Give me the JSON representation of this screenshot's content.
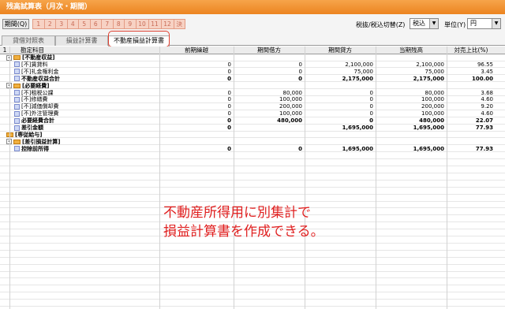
{
  "window": {
    "title": "残高試算表（月次・期間）"
  },
  "period": {
    "button_label": "期間(Q)",
    "months": [
      "1",
      "2",
      "3",
      "4",
      "5",
      "6",
      "7",
      "8",
      "9",
      "10",
      "11",
      "12",
      "決"
    ]
  },
  "tax": {
    "label": "税抜/税込切替(Z)",
    "value": "税込"
  },
  "unit": {
    "label": "単位(Y)",
    "value": "円"
  },
  "tabs": [
    "貸借対照表",
    "損益計算書",
    "不動産損益計算書"
  ],
  "grid": {
    "corner": "1",
    "headers": [
      "勘定科目",
      "前期繰越",
      "期間借方",
      "期間貸方",
      "当期残高",
      "対売上比(%)"
    ],
    "rows": [
      {
        "level": 0,
        "icon": "folder",
        "expand": "-",
        "name": "[不動産収益]",
        "vals": [
          "",
          "",
          "",
          "",
          ""
        ],
        "bold": true
      },
      {
        "level": 1,
        "icon": "doc",
        "name": "[不]賃貸料",
        "vals": [
          "0",
          "0",
          "2,100,000",
          "2,100,000",
          "96.55"
        ]
      },
      {
        "level": 1,
        "icon": "doc",
        "name": "[不]礼金権利金",
        "vals": [
          "0",
          "0",
          "75,000",
          "75,000",
          "3.45"
        ]
      },
      {
        "level": 1,
        "icon": "doc",
        "name": "不動産収益合計",
        "vals": [
          "0",
          "0",
          "2,175,000",
          "2,175,000",
          "100.00"
        ],
        "bold": true
      },
      {
        "level": 0,
        "icon": "folder",
        "expand": "-",
        "name": "[必要経費]",
        "vals": [
          "",
          "",
          "",
          "",
          ""
        ],
        "bold": true
      },
      {
        "level": 1,
        "icon": "doc",
        "name": "[不]租税公課",
        "vals": [
          "0",
          "80,000",
          "0",
          "80,000",
          "3.68"
        ]
      },
      {
        "level": 1,
        "icon": "doc",
        "name": "[不]修繕費",
        "vals": [
          "0",
          "100,000",
          "0",
          "100,000",
          "4.60"
        ]
      },
      {
        "level": 1,
        "icon": "doc",
        "name": "[不]減価償却費",
        "vals": [
          "0",
          "200,000",
          "0",
          "200,000",
          "9.20"
        ]
      },
      {
        "level": 1,
        "icon": "doc",
        "name": "[不]外注管理費",
        "vals": [
          "0",
          "100,000",
          "0",
          "100,000",
          "4.60"
        ]
      },
      {
        "level": 1,
        "icon": "doc",
        "name": "必要経費合計",
        "vals": [
          "0",
          "480,000",
          "0",
          "480,000",
          "22.07"
        ],
        "bold": true
      },
      {
        "level": 1,
        "icon": "doc",
        "name": "差引金額",
        "vals": [
          "0",
          "",
          "1,695,000",
          "1,695,000",
          "77.93"
        ],
        "bold": true
      },
      {
        "level": 0,
        "icon": "folder",
        "name": "[専従給与]",
        "vals": [
          "",
          "",
          "",
          "",
          ""
        ],
        "bold": true
      },
      {
        "level": 0,
        "icon": "folder",
        "expand": "-",
        "name": "[差引損益計算]",
        "vals": [
          "",
          "",
          "",
          "",
          ""
        ],
        "bold": true
      },
      {
        "level": 1,
        "icon": "doc",
        "name": "控除前所得",
        "vals": [
          "0",
          "0",
          "1,695,000",
          "1,695,000",
          "77.93"
        ],
        "bold": true
      }
    ]
  },
  "caption": {
    "line1": "不動産所得用に別集計で",
    "line2": "損益計算書を作成できる。"
  },
  "colors": {
    "title_bg": "#ec8420",
    "caption": "#e02020",
    "month_cell": "#f7d2c4"
  }
}
